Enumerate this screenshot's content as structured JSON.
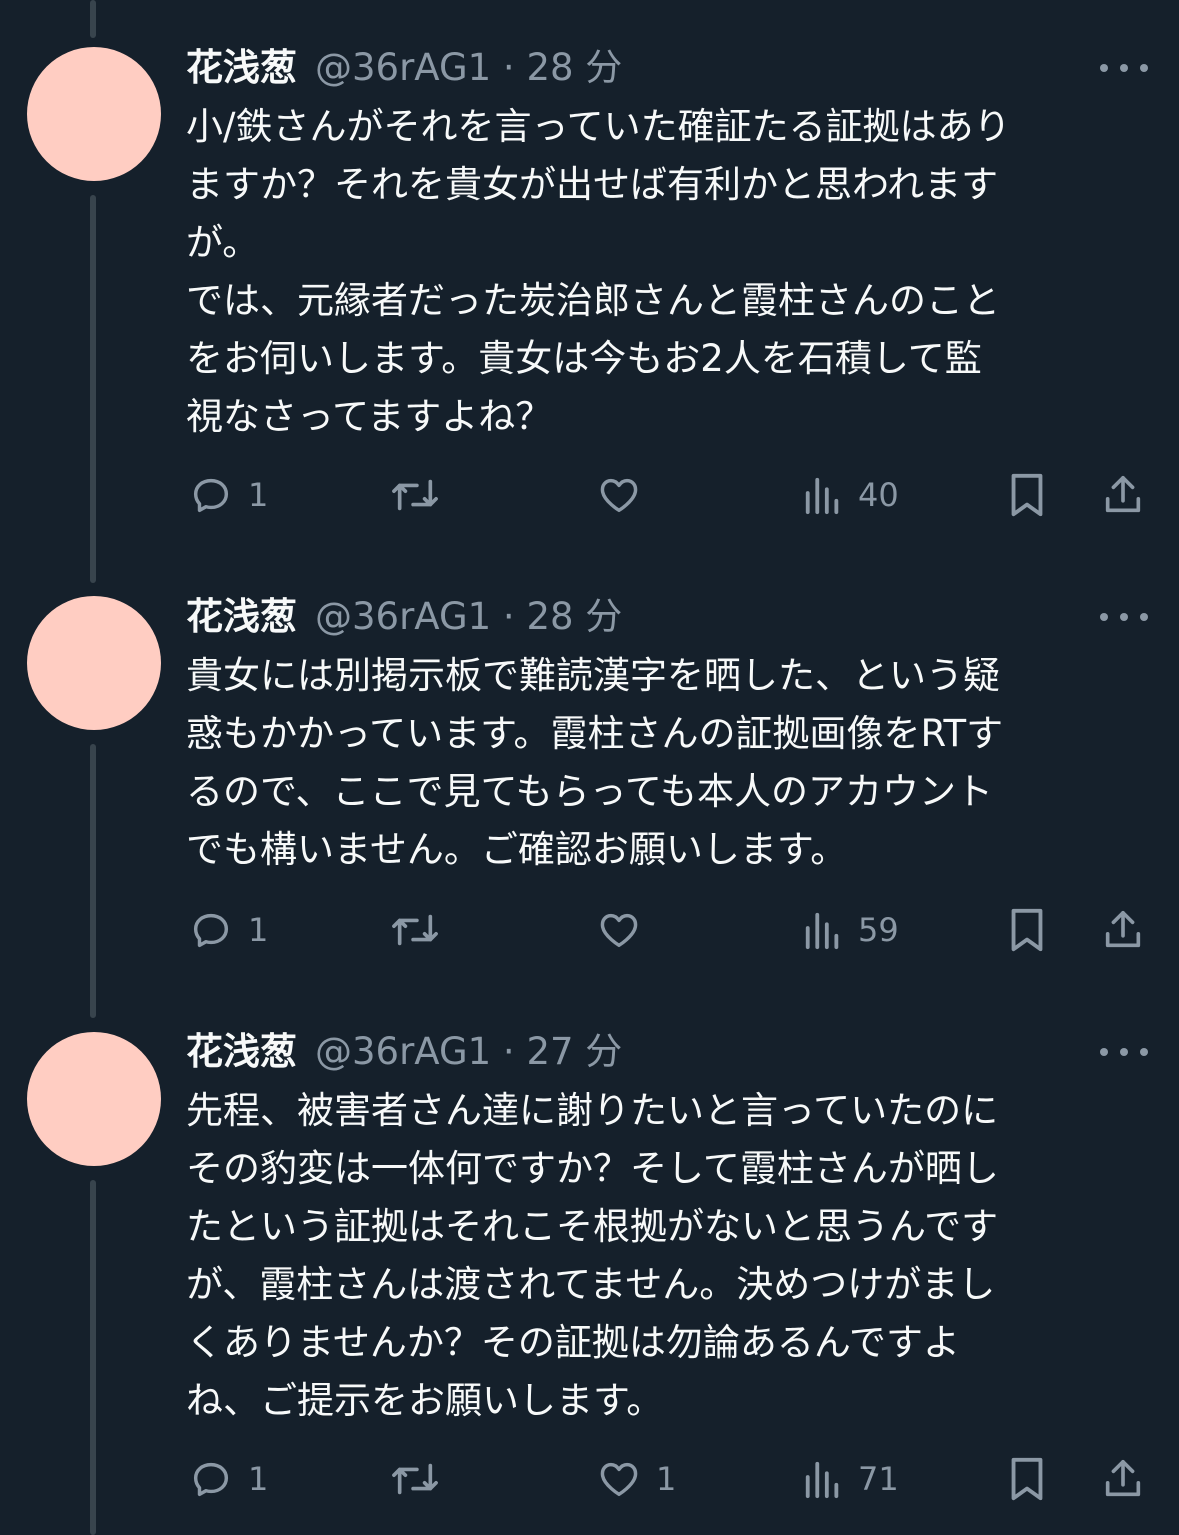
{
  "tweets": [
    {
      "name": "花浅葱",
      "handle": "@36rAG1 · 28 分",
      "text": "小/鉄さんがそれを言っていた確証たる証拠はあり\nますか？それを貴女が出せば有利かと思われます\nが。\nでは、元縁者だった炭治郎さんと霞柱さんのこと\nをお伺いします。貴女は今もお2人を石積して監\n視なさってますよね？",
      "replies": "1",
      "retweets": "",
      "likes": "",
      "views": "40"
    },
    {
      "name": "花浅葱",
      "handle": "@36rAG1 · 28 分",
      "text": "貴女には別掲示板で難読漢字を晒した、という疑\n惑もかかっています。霞柱さんの証拠画像をRTす\nるので、ここで見てもらっても本人のアカウント\nでも構いません。ご確認お願いします。",
      "replies": "1",
      "retweets": "",
      "likes": "",
      "views": "59"
    },
    {
      "name": "花浅葱",
      "handle": "@36rAG1 · 27 分",
      "text": "先程、被害者さん達に謝りたいと言っていたのに\nその豹変は一体何ですか？そして霞柱さんが晒し\nたという証拠はそれこそ根拠がないと思うんです\nが、霞柱さんは渡されてません。決めつけがまし\nくありませんか？その証拠は勿論あるんですよ\nね、ご提示をお願いします。",
      "replies": "1",
      "retweets": "",
      "likes": "1",
      "views": "71"
    }
  ],
  "icons": {
    "reply": "reply-icon",
    "retweet": "retweet-icon",
    "like": "heart-icon",
    "views": "views-icon",
    "bookmark": "bookmark-icon",
    "share": "share-icon",
    "more": "more-icon"
  },
  "colors": {
    "background": "#15202b",
    "text": "#f7f9f9",
    "muted": "#8b98a5",
    "thread_line": "#38444d",
    "avatar": "#ffcdc2"
  }
}
